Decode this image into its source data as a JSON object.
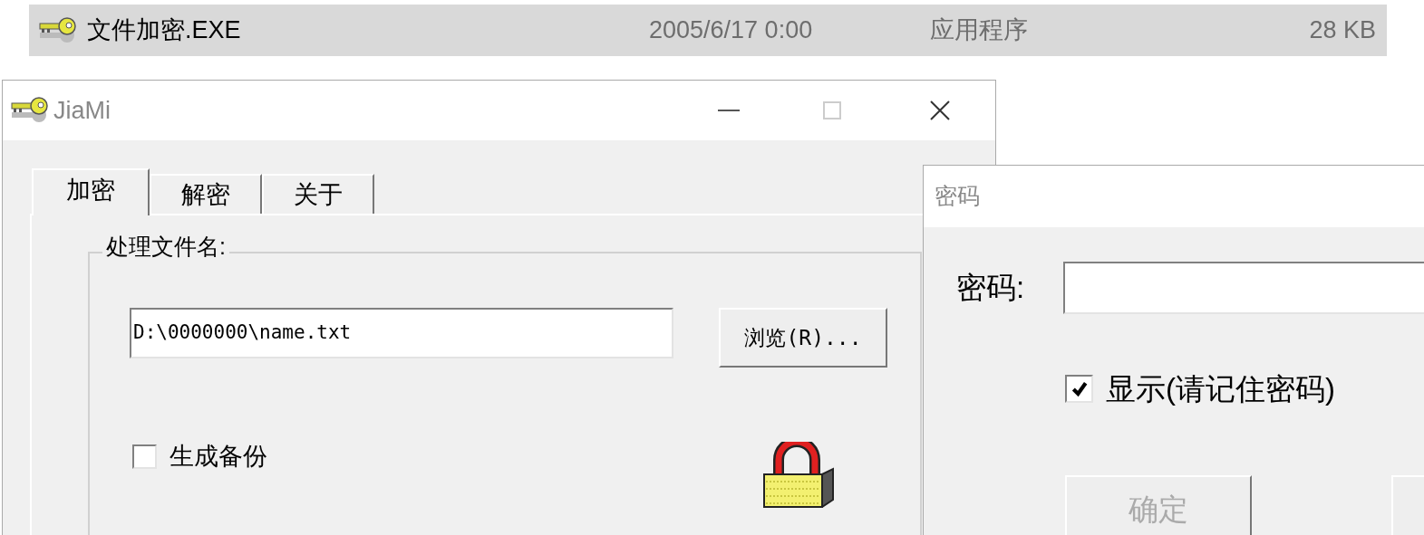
{
  "file_row": {
    "name": "文件加密.EXE",
    "date": "2005/6/17 0:00",
    "type": "应用程序",
    "size": "28 KB",
    "selected": true
  },
  "main_window": {
    "title": "JiaMi",
    "tabs": [
      {
        "label": "加密",
        "selected": true
      },
      {
        "label": "解密",
        "selected": false
      },
      {
        "label": "关于",
        "selected": false
      }
    ],
    "group": {
      "title": "处理文件名:",
      "file_field": {
        "value": "D:\\0000000\\name.txt"
      },
      "browse_button": "浏览(R)...",
      "backup_checkbox": {
        "label": "生成备份",
        "checked": false
      }
    }
  },
  "password_dialog": {
    "title": "密码",
    "field_label": "密码:",
    "show_checkbox": {
      "label": "显示(请记住密码)",
      "checked": true
    },
    "buttons": [
      {
        "label": "确定",
        "disabled": true
      }
    ]
  }
}
